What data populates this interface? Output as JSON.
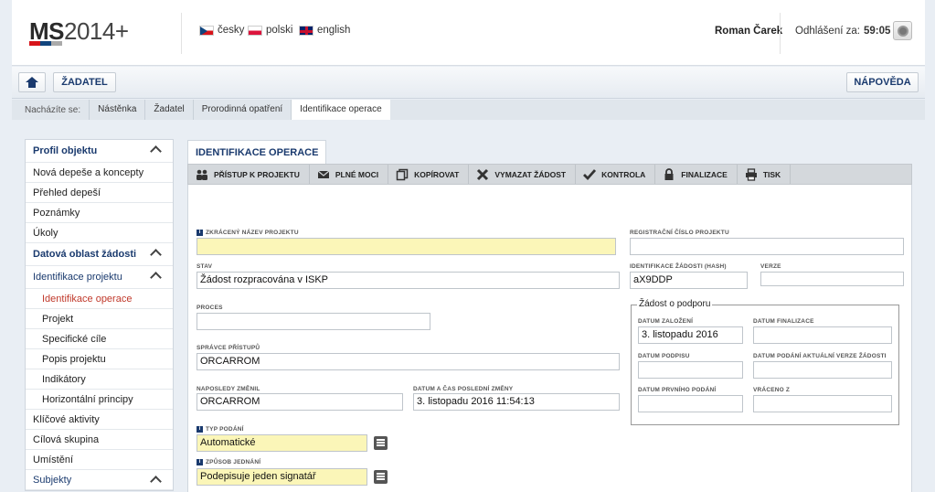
{
  "header": {
    "logo_main": "MS",
    "logo_year": "2014+",
    "languages": [
      {
        "code": "cz",
        "label": "česky"
      },
      {
        "code": "pl",
        "label": "polski"
      },
      {
        "code": "en",
        "label": "english"
      }
    ],
    "user_name": "Roman Čarek",
    "logout_label": "Odhlášení za:",
    "logout_timer": "59:05"
  },
  "toolbar": {
    "applicant_label": "ŽADATEL",
    "help_label": "NÁPOVĚDA"
  },
  "breadcrumb": {
    "lead": "Nacházíte se:",
    "items": [
      "Nástěnka",
      "Žadatel",
      "Prorodinná opatření",
      "Identifikace operace"
    ]
  },
  "sidebar": {
    "items": [
      {
        "label": "Profil objektu"
      },
      {
        "label": "Nová depeše a koncepty"
      },
      {
        "label": "Přehled depeší"
      },
      {
        "label": "Poznámky"
      },
      {
        "label": "Úkoly"
      },
      {
        "label": "Datová oblast žádosti"
      },
      {
        "label": "Identifikace projektu"
      },
      {
        "label": "Identifikace operace"
      },
      {
        "label": "Projekt"
      },
      {
        "label": "Specifické cíle"
      },
      {
        "label": "Popis projektu"
      },
      {
        "label": "Indikátory"
      },
      {
        "label": "Horizontální principy"
      },
      {
        "label": "Klíčové aktivity"
      },
      {
        "label": "Cílová skupina"
      },
      {
        "label": "Umístění"
      },
      {
        "label": "Subjekty"
      }
    ]
  },
  "main": {
    "tab_title": "IDENTIFIKACE OPERACE",
    "actions": [
      {
        "label": "PŘÍSTUP K PROJEKTU",
        "icon": "users-icon"
      },
      {
        "label": "PLNÉ MOCI",
        "icon": "envelope-icon"
      },
      {
        "label": "KOPÍROVAT",
        "icon": "copy-icon"
      },
      {
        "label": "VYMAZAT ŽÁDOST",
        "icon": "delete-icon"
      },
      {
        "label": "KONTROLA",
        "icon": "check-icon"
      },
      {
        "label": "FINALIZACE",
        "icon": "lock-icon"
      },
      {
        "label": "TISK",
        "icon": "print-icon"
      }
    ],
    "fields": {
      "short_name_label": "ZKRÁCENÝ NÁZEV PROJEKTU",
      "short_name_value": "",
      "reg_no_label": "REGISTRAČNÍ ČÍSLO PROJEKTU",
      "reg_no_value": "",
      "status_label": "STAV",
      "status_value": "Žádost rozpracována v ISKP",
      "hash_label": "IDENTIFIKACE ŽÁDOSTI (HASH)",
      "hash_value": "aX9DDP",
      "version_label": "VERZE",
      "version_value": "",
      "process_label": "PROCES",
      "process_value": "",
      "admin_label": "SPRÁVCE PŘÍSTUPŮ",
      "admin_value": "ORCARROM",
      "last_changed_label": "NAPOSLEDY ZMĚNIL",
      "last_changed_value": "ORCARROM",
      "last_change_date_label": "DATUM A ČAS POSLEDNÍ ZMĚNY",
      "last_change_date_value": "3. listopadu 2016 11:54:13",
      "submit_type_label": "TYP PODÁNÍ",
      "submit_type_value": "Automatické",
      "method_label": "ZPŮSOB JEDNÁNÍ",
      "method_value": "Podepisuje jeden signatář"
    },
    "support": {
      "legend": "Žádost o podporu",
      "created_label": "DATUM ZALOŽENÍ",
      "created_value": "3. listopadu 2016",
      "finalized_label": "DATUM FINALIZACE",
      "finalized_value": "",
      "signed_label": "DATUM PODPISU",
      "signed_value": "",
      "current_submit_label": "DATUM PODÁNÍ AKTUÁLNÍ VERZE ŽÁDOSTI",
      "current_submit_value": "",
      "first_submit_label": "DATUM PRVNÍHO PODÁNÍ",
      "first_submit_value": "",
      "returned_label": "VRÁCENO Z",
      "returned_value": ""
    }
  }
}
